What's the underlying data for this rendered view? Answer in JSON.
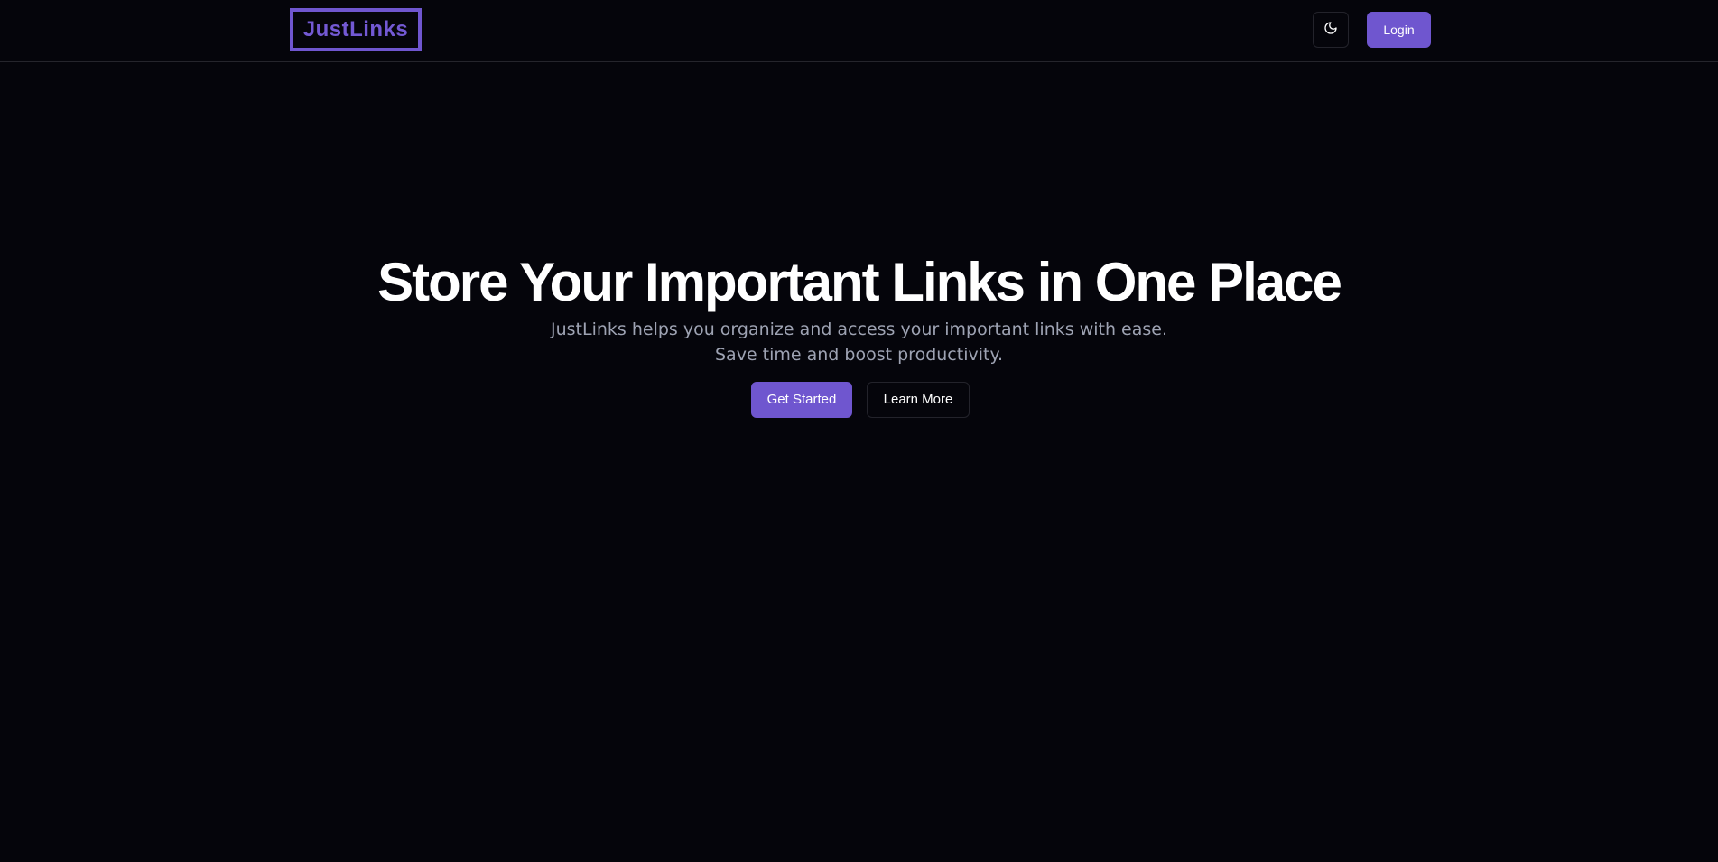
{
  "header": {
    "logo_text": "JustLinks",
    "theme_toggle_icon": "moon-icon",
    "login_label": "Login"
  },
  "hero": {
    "title": "Store Your Important Links in One Place",
    "subtitle_line1": "JustLinks helps you organize and access your important links with ease.",
    "subtitle_line2": "Save time and boost productivity.",
    "primary_cta": "Get Started",
    "secondary_cta": "Learn More"
  },
  "colors": {
    "background": "#05050b",
    "accent": "#6f56cf",
    "subtitle_text": "#9ea3b3",
    "border": "#23232b"
  }
}
